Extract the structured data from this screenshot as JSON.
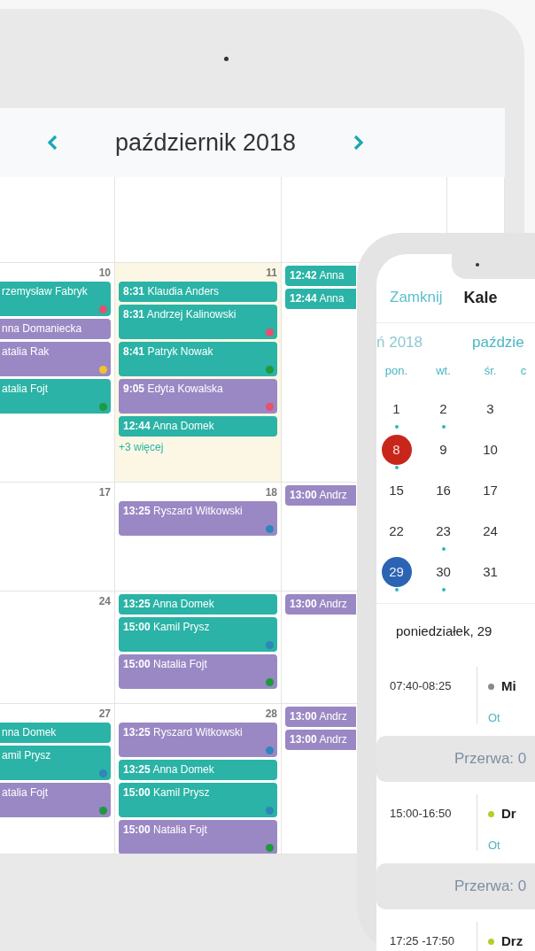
{
  "tablet": {
    "month_title": "październik 2018",
    "weeks": [
      {
        "days": [
          {
            "day": "10",
            "today": false,
            "events": [
              {
                "name": "rzemysław Fabryk",
                "color": "#2ab3a6",
                "status": {
                  "color": "#e8506e"
                }
              },
              {
                "name": "nna Domaniecka",
                "color": "#9a88c4"
              },
              {
                "name": "atalia Rak",
                "color": "#9a88c4",
                "status": {
                  "color": "#f2c12e"
                }
              },
              {
                "name": "atalia Fojt",
                "color": "#2ab3a6",
                "status": {
                  "color": "#1e9a3c"
                }
              }
            ]
          },
          {
            "day": "11",
            "today": true,
            "more": "+3 więcej",
            "events": [
              {
                "time": "8:31",
                "name": "Klaudia Anders",
                "color": "#2ab3a6"
              },
              {
                "time": "8:31",
                "name": "Andrzej Kalinowski",
                "color": "#2ab3a6",
                "status": {
                  "color": "#e8506e"
                }
              },
              {
                "time": "8:41",
                "name": "Patryk Nowak",
                "color": "#2ab3a6",
                "status": {
                  "color": "#1e9a3c"
                }
              },
              {
                "time": "9:05",
                "name": "Edyta Kowalska",
                "color": "#9a88c4",
                "status": {
                  "color": "#e8506e"
                }
              },
              {
                "time": "12:44",
                "name": "Anna Domek",
                "color": "#2ab3a6"
              }
            ]
          },
          {
            "today": false,
            "events": [
              {
                "time": "12:42",
                "name": "Anna",
                "color": "#2ab3a6"
              },
              {
                "time": "12:44",
                "name": "Anna",
                "color": "#2ab3a6"
              }
            ]
          }
        ]
      },
      {
        "days": [
          {
            "day": "17",
            "today": false
          },
          {
            "day": "18",
            "today": false,
            "events": [
              {
                "time": "13:25",
                "name": "Ryszard Witkowski",
                "color": "#9a88c4",
                "status": {
                  "color": "#2f86b8"
                }
              }
            ]
          },
          {
            "today": false,
            "events": [
              {
                "time": "13:00",
                "name": "Andrz",
                "color": "#9a88c4"
              }
            ]
          }
        ]
      },
      {
        "days": [
          {
            "day": "24",
            "today": false
          },
          {
            "today": false,
            "events": [
              {
                "time": "13:25",
                "name": "Anna Domek",
                "color": "#2ab3a6"
              },
              {
                "time": "15:00",
                "name": "Kamil Prysz",
                "color": "#2ab3a6",
                "status": {
                  "color": "#2f86b8"
                }
              },
              {
                "time": "15:00",
                "name": "Natalia Fojt",
                "color": "#9a88c4",
                "status": {
                  "color": "#1e9a3c"
                }
              }
            ]
          },
          {
            "today": false,
            "events": [
              {
                "time": "13:00",
                "name": "Andrz",
                "color": "#9a88c4"
              }
            ]
          }
        ]
      },
      {
        "days": [
          {
            "day": "27",
            "today": false,
            "events": [
              {
                "name": "nna Domek",
                "color": "#2ab3a6"
              },
              {
                "name": "amil Prysz",
                "color": "#2ab3a6",
                "status": {
                  "color": "#2f86b8"
                }
              },
              {
                "name": "atalia Fojt",
                "color": "#9a88c4",
                "status": {
                  "color": "#1e9a3c"
                }
              }
            ]
          },
          {
            "day": "28",
            "today": false,
            "events": [
              {
                "time": "13:25",
                "name": "Ryszard Witkowski",
                "color": "#9a88c4",
                "status": {
                  "color": "#2f86b8"
                }
              },
              {
                "time": "13:25",
                "name": "Anna Domek",
                "color": "#2ab3a6"
              },
              {
                "time": "15:00",
                "name": "Kamil Prysz",
                "color": "#2ab3a6",
                "status": {
                  "color": "#2f86b8"
                }
              },
              {
                "time": "15:00",
                "name": "Natalia Fojt",
                "color": "#9a88c4",
                "status": {
                  "color": "#1e9a3c"
                }
              }
            ]
          },
          {
            "today": false,
            "events": [
              {
                "time": "13:00",
                "name": "Andrz",
                "color": "#9a88c4"
              },
              {
                "time": "13:00",
                "name": "Andrz",
                "color": "#9a88c4"
              }
            ]
          }
        ]
      }
    ]
  },
  "phone": {
    "close": "Zamknij",
    "title": "Kale",
    "prev_month": "ń 2018",
    "month": "paździe",
    "weekdays": [
      "pon.",
      "wt.",
      "śr.",
      "c"
    ],
    "weeks": [
      {
        "days": [
          {
            "day": "1",
            "today": false,
            "selected": false,
            "has_events": true
          },
          {
            "day": "2",
            "today": false,
            "selected": false,
            "has_events": true
          },
          {
            "day": "3",
            "today": false,
            "selected": false,
            "has_events": false
          }
        ]
      },
      {
        "days": [
          {
            "day": "8",
            "today": true,
            "selected": false,
            "has_events": true
          },
          {
            "day": "9",
            "today": false,
            "selected": false,
            "has_events": false
          },
          {
            "day": "10",
            "today": false,
            "selected": false,
            "has_events": false
          }
        ]
      },
      {
        "days": [
          {
            "day": "15",
            "today": false,
            "selected": false,
            "has_events": false
          },
          {
            "day": "16",
            "today": false,
            "selected": false,
            "has_events": false
          },
          {
            "day": "17",
            "today": false,
            "selected": false,
            "has_events": false
          }
        ]
      },
      {
        "days": [
          {
            "day": "22",
            "today": false,
            "selected": false,
            "has_events": false
          },
          {
            "day": "23",
            "today": false,
            "selected": false,
            "has_events": true
          },
          {
            "day": "24",
            "today": false,
            "selected": false,
            "has_events": false
          }
        ]
      },
      {
        "days": [
          {
            "day": "29",
            "today": false,
            "selected": true,
            "has_events": true
          },
          {
            "day": "30",
            "today": false,
            "selected": false,
            "has_events": true
          },
          {
            "day": "31",
            "today": false,
            "selected": false,
            "has_events": false
          }
        ]
      }
    ],
    "day_heading": "poniedziałek, 29",
    "agenda": [
      {
        "kind": "appointment",
        "time": "07:40-08:25",
        "title": "Mi",
        "link": "Ot",
        "color": "#8a8a8a"
      },
      {
        "kind": "break",
        "label": "Przerwa: 0"
      },
      {
        "kind": "appointment",
        "time": "15:00-16:50",
        "title": "Dr",
        "link": "Ot",
        "color": "#b9cc2a"
      },
      {
        "kind": "break",
        "label": "Przerwa: 0"
      },
      {
        "kind": "appointment",
        "time": "17:25 -17:50",
        "title": "Drz",
        "color": "#b9cc2a"
      }
    ]
  }
}
